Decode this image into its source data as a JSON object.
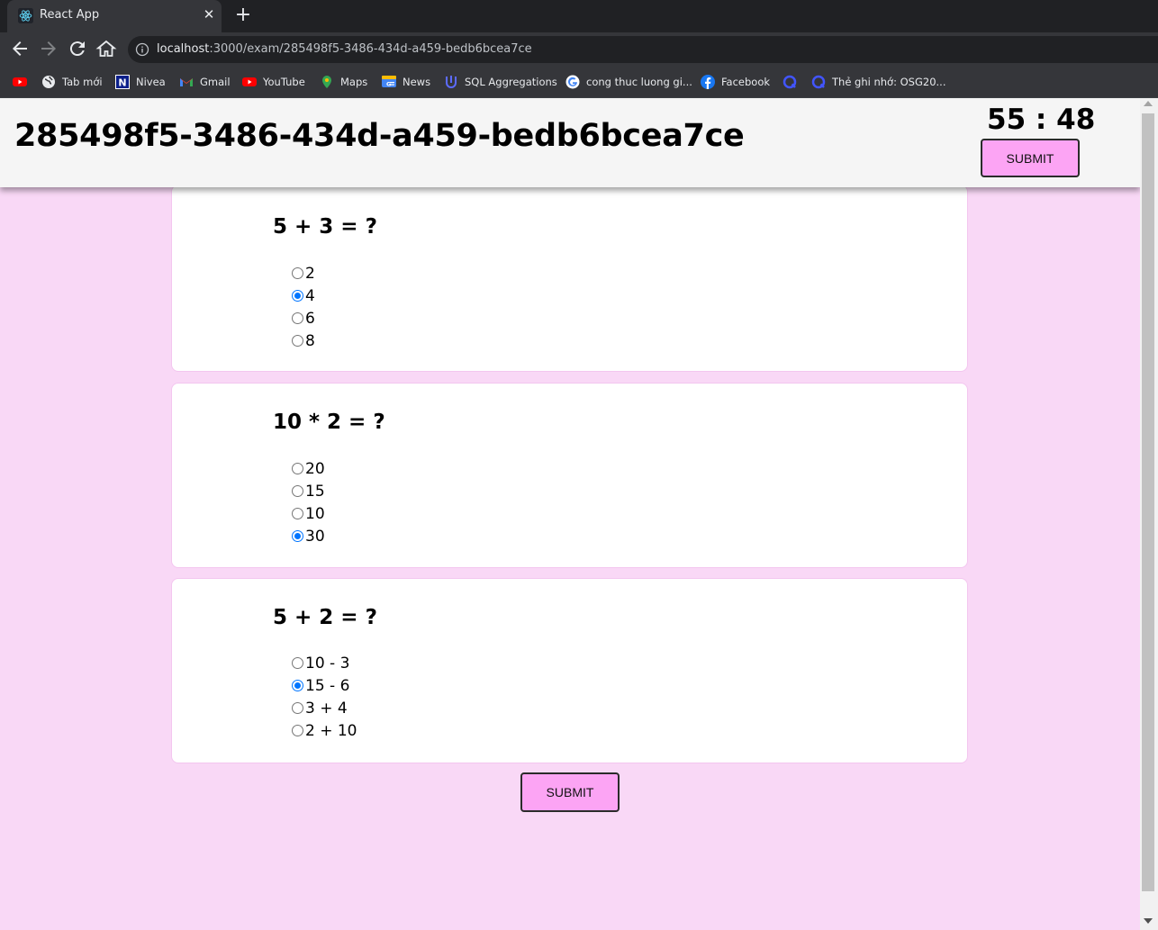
{
  "browser": {
    "tab_title": "React App",
    "url_host": "localhost",
    "url_path": ":3000/exam/285498f5-3486-434d-a459-bedb6bcea7ce",
    "bookmarks": [
      {
        "label": "",
        "icon": "youtube-icon"
      },
      {
        "label": "Tab mới",
        "icon": "globe-icon"
      },
      {
        "label": "Nivea",
        "icon": "nivea-icon"
      },
      {
        "label": "Gmail",
        "icon": "gmail-icon"
      },
      {
        "label": "YouTube",
        "icon": "youtube-icon"
      },
      {
        "label": "Maps",
        "icon": "maps-icon"
      },
      {
        "label": "News",
        "icon": "news-icon"
      },
      {
        "label": "SQL Aggregations",
        "icon": "udacity-icon"
      },
      {
        "label": "cong thuc luong gi...",
        "icon": "google-icon"
      },
      {
        "label": "Facebook",
        "icon": "facebook-icon"
      },
      {
        "label": "",
        "icon": "quizlet-icon"
      },
      {
        "label": "Thẻ ghi nhớ: OSG20...",
        "icon": "quizlet-icon"
      }
    ]
  },
  "header": {
    "exam_id": "285498f5-3486-434d-a459-bedb6bcea7ce",
    "timer": "55 : 48",
    "submit_label": "SUBMIT"
  },
  "questions": [
    {
      "text": "5 + 3 = ?",
      "options": [
        "2",
        "4",
        "6",
        "8"
      ],
      "selected": 1
    },
    {
      "text": "10 * 2 = ?",
      "options": [
        "20",
        "15",
        "10",
        "30"
      ],
      "selected": 3
    },
    {
      "text": "5 + 2 = ?",
      "options": [
        "10 - 3",
        "15 - 6",
        "3 + 4",
        "2 + 10"
      ],
      "selected": 1
    }
  ],
  "footer": {
    "submit_label": "SUBMIT"
  },
  "colors": {
    "page_bg": "#f9d8f6",
    "button_bg": "#fca4f4",
    "radio_accent": "#0075ff"
  }
}
